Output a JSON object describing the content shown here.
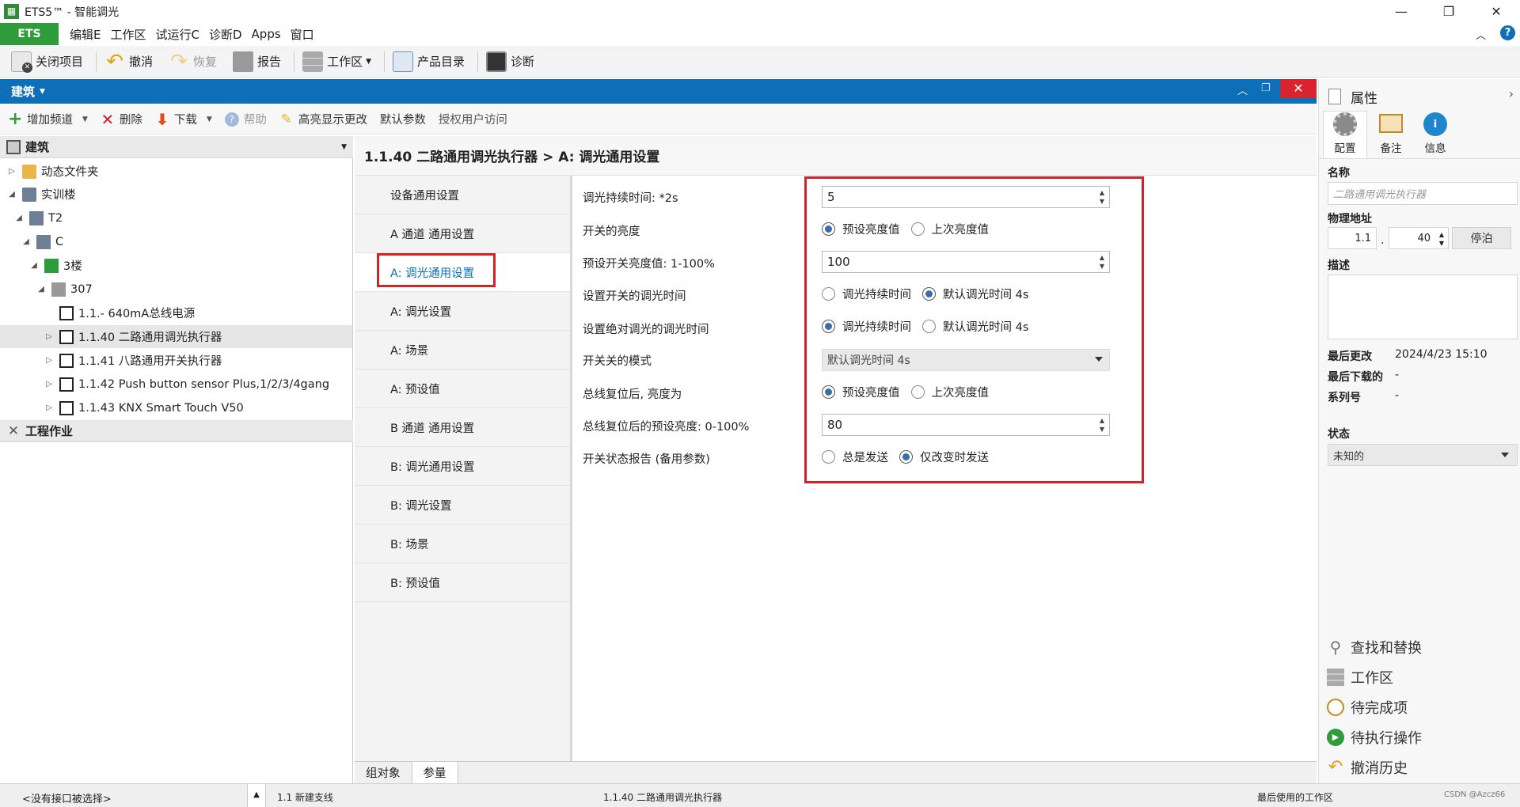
{
  "window": {
    "title": "ETS5™ - 智能调光",
    "logo": "ETS-app-icon"
  },
  "menu": {
    "ets": "ETS",
    "items": [
      "编辑E",
      "工作区",
      "试运行C",
      "诊断D",
      "Apps",
      "窗口"
    ]
  },
  "toolbar": {
    "close_project": "关闭项目",
    "undo": "撤消",
    "redo": "恢复",
    "report": "报告",
    "workspace": "工作区",
    "catalog": "产品目录",
    "diagnostics": "诊断"
  },
  "panel": {
    "title": "建筑"
  },
  "toolbar2": {
    "add_channel": "增加频道",
    "delete": "删除",
    "download": "下载",
    "help": "帮助",
    "highlight": "高亮显示更改",
    "default_params": "默认参数",
    "auth": "授权用户访问"
  },
  "tree": {
    "header": "建筑",
    "items": [
      "动态文件夹",
      "实训楼",
      "T2",
      "C",
      "3楼",
      "307",
      "1.1.- 640mA总线电源",
      "1.1.40 二路通用调光执行器",
      "1.1.41 八路通用开关执行器",
      "1.1.42 Push button sensor Plus,1/2/3/4gang",
      "1.1.43 KNX Smart Touch V50"
    ],
    "footer": "工程作业"
  },
  "main": {
    "header": "1.1.40 二路通用调光执行器 > A: 调光通用设置",
    "nav": [
      "设备通用设置",
      "A 通道 通用设置",
      "A: 调光通用设置",
      "A: 调光设置",
      "A: 场景",
      "A: 预设值",
      "B 通道 通用设置",
      "B: 调光通用设置",
      "B: 调光设置",
      "B: 场景",
      "B: 预设值"
    ],
    "params": {
      "dim_duration": {
        "label": "调光持续时间: *2s",
        "value": "5"
      },
      "switch_brightness": {
        "label": "开关的亮度",
        "opt1": "预设亮度值",
        "opt2": "上次亮度值"
      },
      "preset_brightness": {
        "label": "预设开关亮度值: 1-100%",
        "value": "100"
      },
      "switch_dim_time": {
        "label": "设置开关的调光时间",
        "opt1": "调光持续时间",
        "opt2": "默认调光时间 4s"
      },
      "abs_dim_time": {
        "label": "设置绝对调光的调光时间",
        "opt1": "调光持续时间",
        "opt2": "默认调光时间 4s"
      },
      "switch_mode": {
        "label": "开关关的模式",
        "value": "默认调光时间 4s"
      },
      "bus_recovery": {
        "label": "总线复位后, 亮度为",
        "opt1": "预设亮度值",
        "opt2": "上次亮度值"
      },
      "bus_recovery_preset": {
        "label": "总线复位后的预设亮度: 0-100%",
        "value": "80"
      },
      "status_report": {
        "label": "开关状态报告 (备用参数)",
        "opt1": "总是发送",
        "opt2": "仅改变时发送"
      }
    },
    "tabs": [
      "组对象",
      "参量"
    ]
  },
  "status": {
    "interface": "<没有接口被选择>",
    "line": "1.1 新建支线",
    "device": "1.1.40 二路通用调光执行器",
    "workspace": "最后使用的工作区",
    "watermark": "CSDN @Azcz66"
  },
  "props": {
    "title": "属性",
    "tabs": [
      "配置",
      "备注",
      "信息"
    ],
    "name_label": "名称",
    "name_placeholder": "二路通用调光执行器",
    "phys_label": "物理地址",
    "phys_prefix": "1.1",
    "phys_value": "40",
    "park": "停泊",
    "desc_label": "描述",
    "last_modified_label": "最后更改",
    "last_modified_value": "2024/4/23 15:10",
    "last_download_label": "最后下载的",
    "last_download_value": "-",
    "serial_label": "系列号",
    "serial_value": "-",
    "state_label": "状态",
    "state_value": "未知的",
    "links": [
      "查找和替换",
      "工作区",
      "待完成项",
      "待执行操作",
      "撤消历史"
    ]
  },
  "colors": {
    "accent": "#0d6fb8",
    "ets_green": "#2e9c3a",
    "highlight_red": "#d2232a"
  }
}
